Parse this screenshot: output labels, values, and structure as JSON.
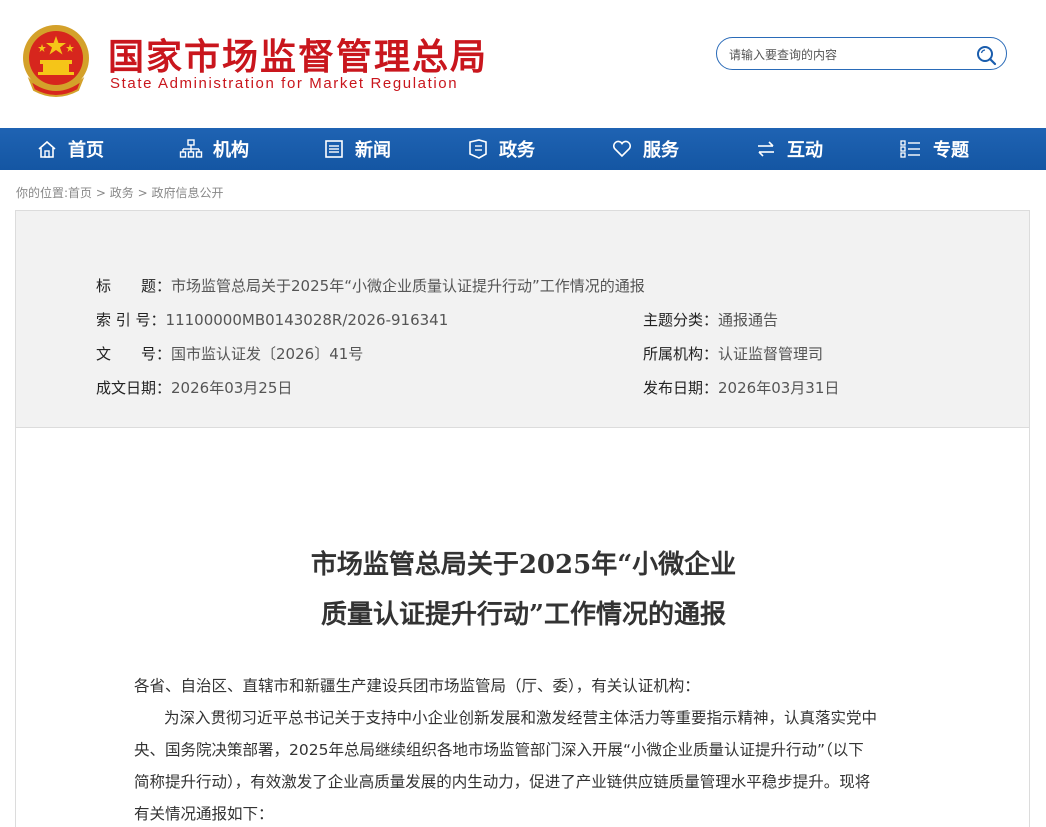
{
  "header": {
    "title": "国家市场监督管理总局",
    "subtitle": "State Administration for Market Regulation",
    "search_placeholder": "请输入要查询的内容"
  },
  "nav": {
    "items": [
      {
        "label": "首页",
        "icon": "home-icon"
      },
      {
        "label": "机构",
        "icon": "org-chart-icon"
      },
      {
        "label": "新闻",
        "icon": "news-icon"
      },
      {
        "label": "政务",
        "icon": "flag-icon"
      },
      {
        "label": "服务",
        "icon": "heart-icon"
      },
      {
        "label": "互动",
        "icon": "exchange-icon"
      },
      {
        "label": "专题",
        "icon": "list-icon"
      }
    ],
    "bg_color": "#1a5dad"
  },
  "breadcrumb": {
    "prefix": "你的位置:",
    "items": [
      "首页",
      "政务",
      "政府信息公开"
    ],
    "separator": " > "
  },
  "info": {
    "title_label": "标　　题：",
    "title_value": "市场监管总局关于2025年“小微企业质量认证提升行动”工作情况的通报",
    "index_label": "索 引 号：",
    "index_value": "11100000MB0143028R/2026-916341",
    "topic_label": "主题分类：",
    "topic_value": "通报通告",
    "docno_label": "文　　号：",
    "docno_value": "国市监认证发〔2026〕41号",
    "org_label": "所属机构：",
    "org_value": "认证监督管理司",
    "created_label": "成文日期：",
    "created_value": "2026年03月25日",
    "published_label": "发布日期：",
    "published_value": "2026年03月31日"
  },
  "document": {
    "title_line1": "市场监管总局关于2025年“小微企业",
    "title_line2": "质量认证提升行动”工作情况的通报",
    "salutation": "各省、自治区、直辖市和新疆生产建设兵团市场监管局（厅、委），有关认证机构：",
    "para1_line1": "为深入贯彻习近平总书记关于支持中小企业创新发展和激发经营主体活力等重要指示精神，认真落实党中",
    "para1_line2": "央、国务院决策部署，2025年总局继续组织各地市场监管部门深入开展“小微企业质量认证提升行动”（以下",
    "para1_line3": "简称提升行动），有效激发了企业高质量发展的内生动力，促进了产业链供应链质量管理水平稳步提升。现将",
    "para1_line4": "有关情况通报如下："
  },
  "colors": {
    "brand_red": "#c9161d",
    "nav_blue": "#1a5dad",
    "info_bg": "#f2f2f2"
  }
}
